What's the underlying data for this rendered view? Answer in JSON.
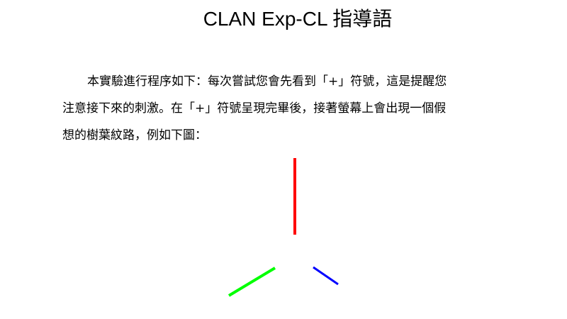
{
  "slide": {
    "title": "CLAN Exp-CL 指導語",
    "instruction_lines": [
      "本實驗進行程序如下：每次嘗試您會先看到「+」符號，這是提醒您",
      "注意接下來的刺激。在「+」符號呈現完畢後，接著螢幕上會出現一個假",
      "想的樹葉紋路，例如下圖："
    ]
  },
  "figure": {
    "lines": [
      {
        "name": "red-line",
        "color": "#ff0000"
      },
      {
        "name": "green-line",
        "color": "#00ff00"
      },
      {
        "name": "blue-line",
        "color": "#0000ff"
      }
    ]
  }
}
